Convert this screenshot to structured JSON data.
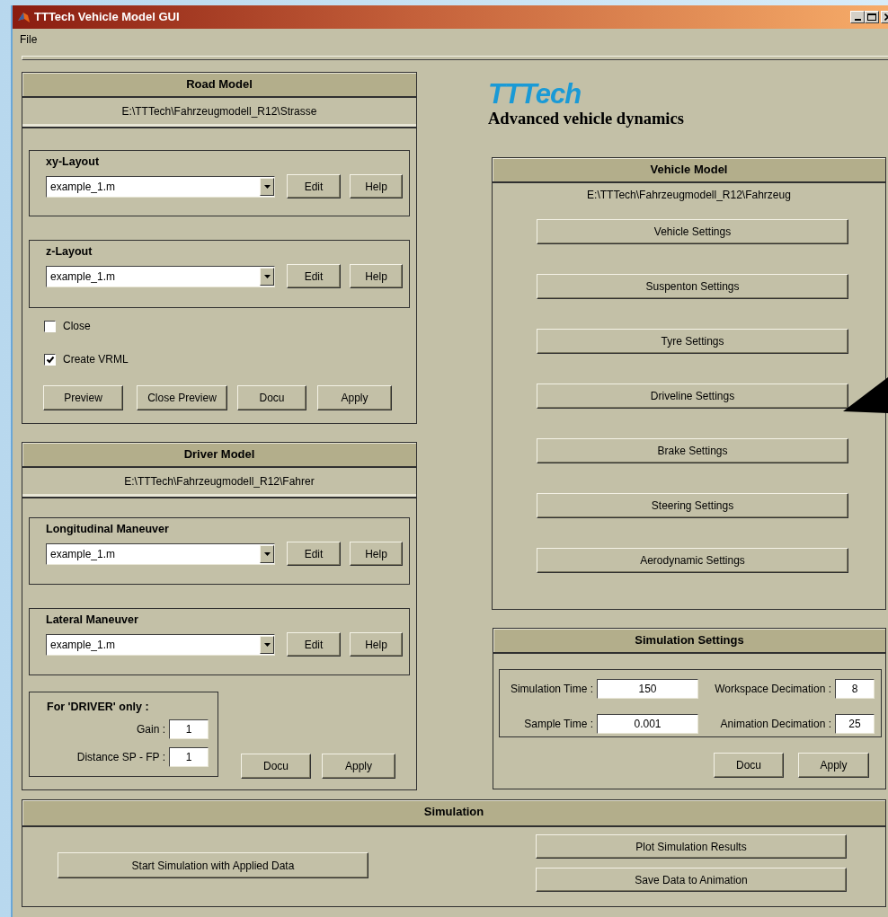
{
  "window": {
    "title": "TTTech Vehicle Model GUI"
  },
  "menu": [
    "File"
  ],
  "road_model": {
    "title": "Road Model",
    "path": "E:\\TTTech\\Fahrzeugmodell_R12\\Strasse",
    "layouts": [
      {
        "label": "xy-Layout",
        "value": "example_1.m",
        "buttons": [
          "Edit",
          "Help"
        ]
      },
      {
        "label": "z-Layout",
        "value": "example_1.m",
        "buttons": [
          "Edit",
          "Help"
        ]
      }
    ],
    "options": [
      {
        "label": "Close",
        "checked": false
      },
      {
        "label": "Create VRML",
        "checked": true
      }
    ],
    "buttons": [
      "Preview",
      "Close Preview",
      "Docu",
      "Apply"
    ]
  },
  "driver_model": {
    "title": "Driver Model",
    "path": "E:\\TTTech\\Fahrzeugmodell_R12\\Fahrer",
    "maneuvers": [
      {
        "label": "Longitudinal Maneuver",
        "value": "example_1.m",
        "buttons": [
          "Edit",
          "Help"
        ]
      },
      {
        "label": "Lateral Maneuver",
        "value": "example_1.m",
        "buttons": [
          "Edit",
          "Help"
        ]
      }
    ],
    "driver_only": {
      "title": "For 'DRIVER' only :",
      "fields": [
        {
          "label": "Gain :",
          "value": "1"
        },
        {
          "label": "Distance SP - FP :",
          "value": "1"
        }
      ]
    },
    "buttons": [
      "Docu",
      "Apply"
    ]
  },
  "branding": {
    "logo": "TTTech",
    "tagline": "Advanced vehicle dynamics"
  },
  "vehicle_model": {
    "title": "Vehicle Model",
    "path": "E:\\TTTech\\Fahrzeugmodell_R12\\Fahrzeug",
    "buttons": [
      "Vehicle Settings",
      "Suspenton Settings",
      "Tyre Settings",
      "Driveline Settings",
      "Brake Settings",
      "Steering Settings",
      "Aerodynamic Settings"
    ]
  },
  "simulation_settings": {
    "title": "Simulation Settings",
    "fields": [
      {
        "label": "Simulation Time :",
        "value": "150"
      },
      {
        "label": "Workspace Decimation :",
        "value": "8"
      },
      {
        "label": "Sample Time :",
        "value": "0.001"
      },
      {
        "label": "Animation Decimation :",
        "value": "25"
      }
    ],
    "buttons": [
      "Docu",
      "Apply"
    ]
  },
  "simulation": {
    "title": "Simulation",
    "start_button": "Start Simulation with Applied Data",
    "buttons": [
      "Plot Simulation Results",
      "Save Data to Animation"
    ]
  }
}
